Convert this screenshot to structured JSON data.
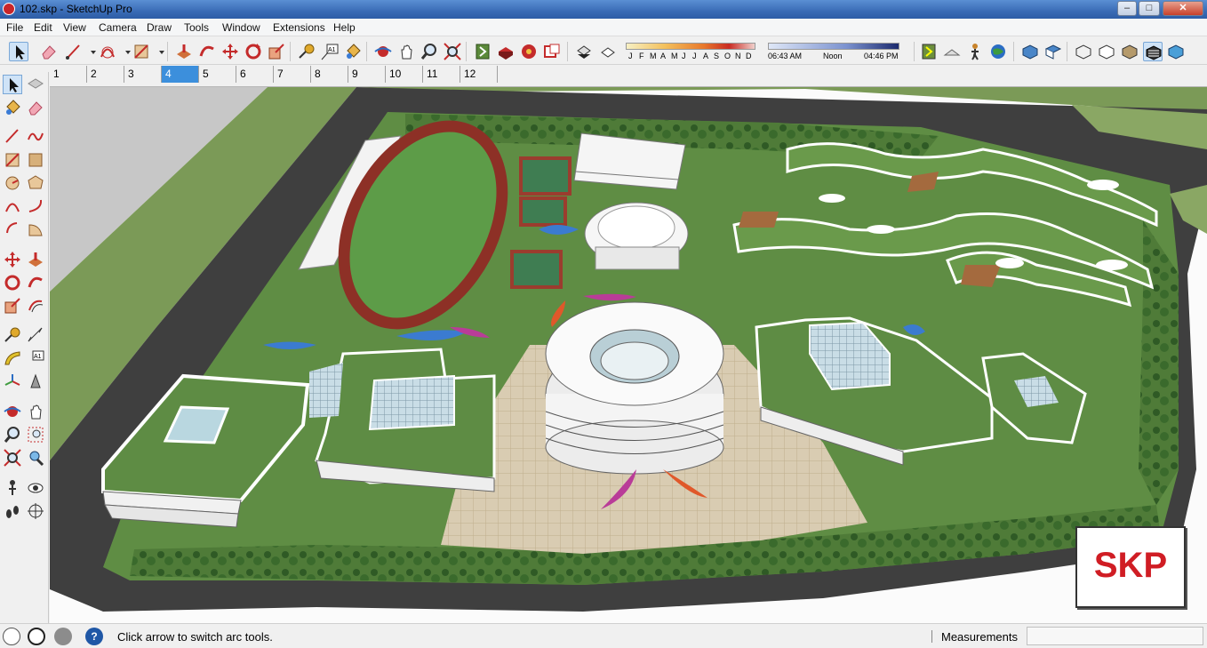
{
  "window": {
    "title": "102.skp - SketchUp Pro",
    "controls": [
      "minimize",
      "maximize",
      "close"
    ]
  },
  "menu": [
    "File",
    "Edit",
    "View",
    "Camera",
    "Draw",
    "Tools",
    "Window",
    "Extensions",
    "Help"
  ],
  "shadow": {
    "months": [
      "J",
      "F",
      "M",
      "A",
      "M",
      "J",
      "J",
      "A",
      "S",
      "O",
      "N",
      "D"
    ],
    "time_start": "06:43 AM",
    "time_mid": "Noon",
    "time_end": "04:46 PM"
  },
  "scenes": [
    "1",
    "2",
    "3",
    "4",
    "5",
    "6",
    "7",
    "8",
    "9",
    "10",
    "11",
    "12"
  ],
  "active_scene": "4",
  "watermark": "SKP",
  "status": {
    "hint": "Click arrow to switch arc tools.",
    "measurements_label": "Measurements",
    "measurements_value": ""
  },
  "colors": {
    "accent": "#3c8fdc",
    "brand_red": "#d01d24",
    "grass": "#5f8d44",
    "road": "#3e3e3e"
  }
}
